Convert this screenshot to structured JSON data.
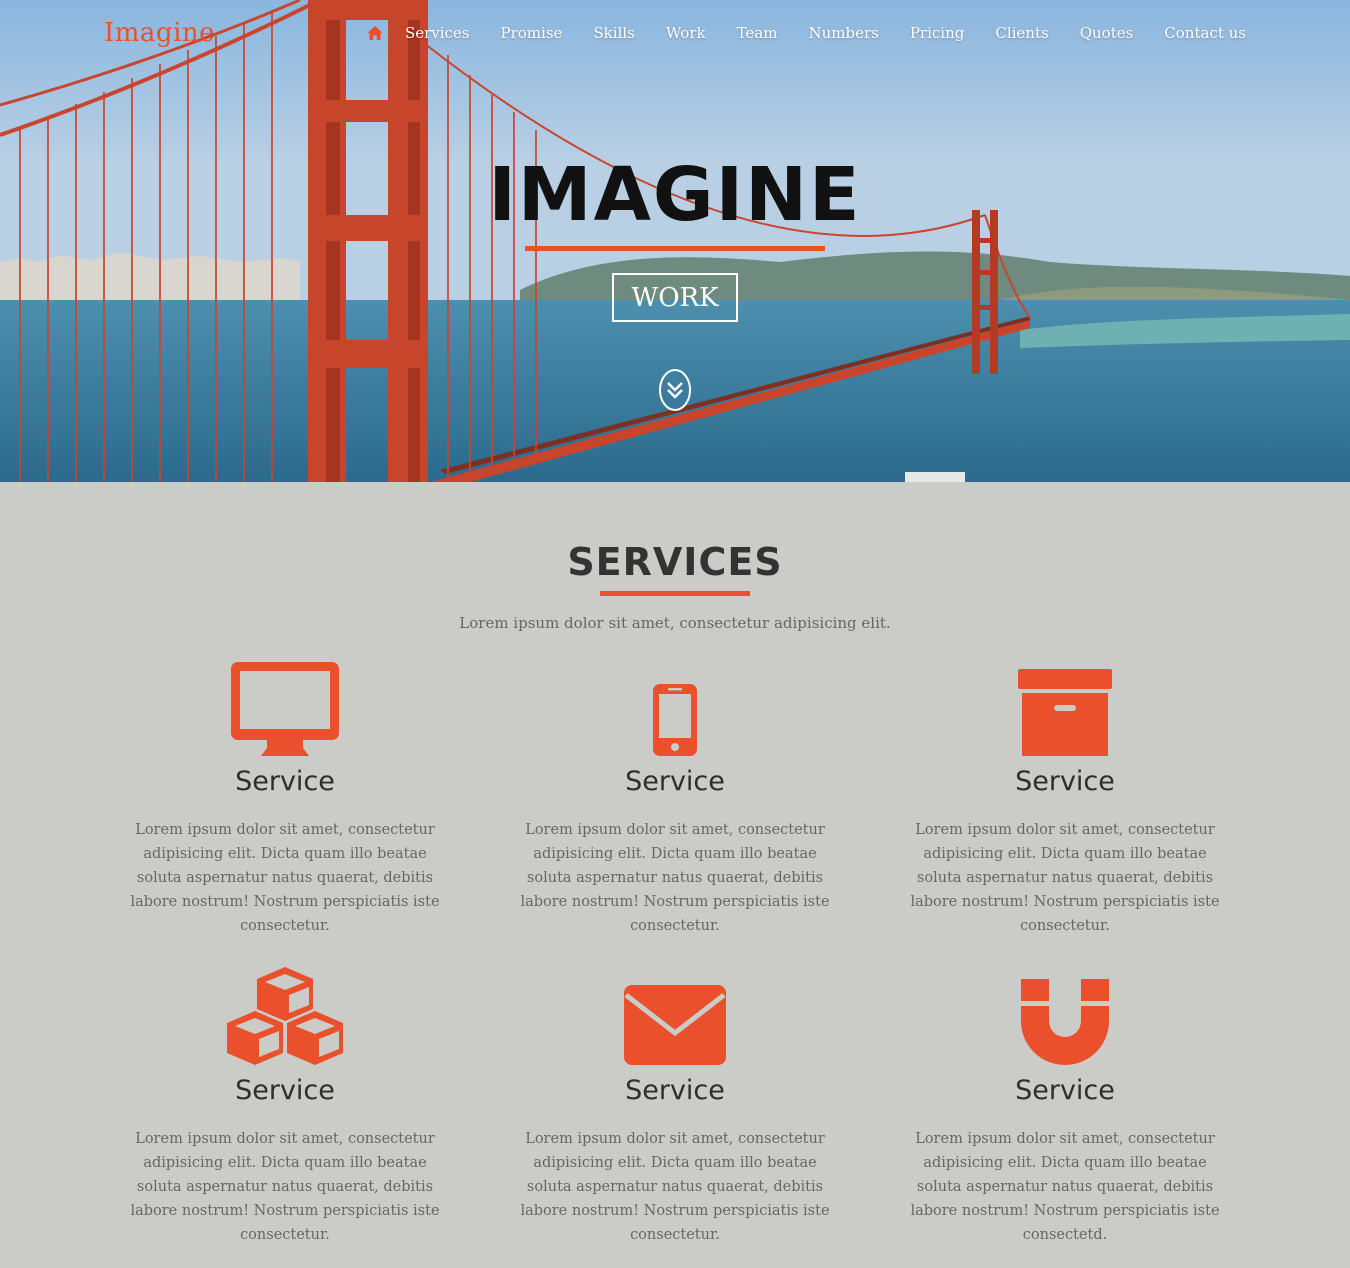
{
  "brand": {
    "logo": "Imagine",
    "accent": "#e9502b"
  },
  "nav": {
    "home_icon": "home-icon",
    "items": [
      "Services",
      "Promise",
      "Skills",
      "Work",
      "Team",
      "Numbers",
      "Pricing",
      "Clients",
      "Quotes",
      "Contact us"
    ]
  },
  "hero": {
    "title": "IMAGINE",
    "button": "WORK",
    "scroll_icon": "double-chevron-down-icon"
  },
  "services": {
    "title": "SERVICES",
    "subtitle": "Lorem ipsum dolor sit amet, consectetur adipisicing elit.",
    "items": [
      {
        "icon": "desktop-icon",
        "title": "Service",
        "text": "Lorem ipsum dolor sit amet, consectetur adipisicing elit. Dicta quam illo beatae soluta aspernatur natus quaerat, debitis labore nostrum! Nostrum perspiciatis iste consectetur."
      },
      {
        "icon": "mobile-icon",
        "title": "Service",
        "text": "Lorem ipsum dolor sit amet, consectetur adipisicing elit. Dicta quam illo beatae soluta aspernatur natus quaerat, debitis labore nostrum! Nostrum perspiciatis iste consectetur."
      },
      {
        "icon": "archive-box-icon",
        "title": "Service",
        "text": "Lorem ipsum dolor sit amet, consectetur adipisicing elit. Dicta quam illo beatae soluta aspernatur natus quaerat, debitis labore nostrum! Nostrum perspiciatis iste consectetur."
      },
      {
        "icon": "cubes-icon",
        "title": "Service",
        "text": "Lorem ipsum dolor sit amet, consectetur adipisicing elit. Dicta quam illo beatae soluta aspernatur natus quaerat, debitis labore nostrum! Nostrum perspiciatis iste consectetur."
      },
      {
        "icon": "envelope-icon",
        "title": "Service",
        "text": "Lorem ipsum dolor sit amet, consectetur adipisicing elit. Dicta quam illo beatae soluta aspernatur natus quaerat, debitis labore nostrum! Nostrum perspiciatis iste consectetur."
      },
      {
        "icon": "magnet-icon",
        "title": "Service",
        "text": "Lorem ipsum dolor sit amet, consectetur adipisicing elit. Dicta quam illo beatae soluta aspernatur natus quaerat, debitis labore nostrum! Nostrum perspiciatis iste consectetd."
      }
    ]
  }
}
